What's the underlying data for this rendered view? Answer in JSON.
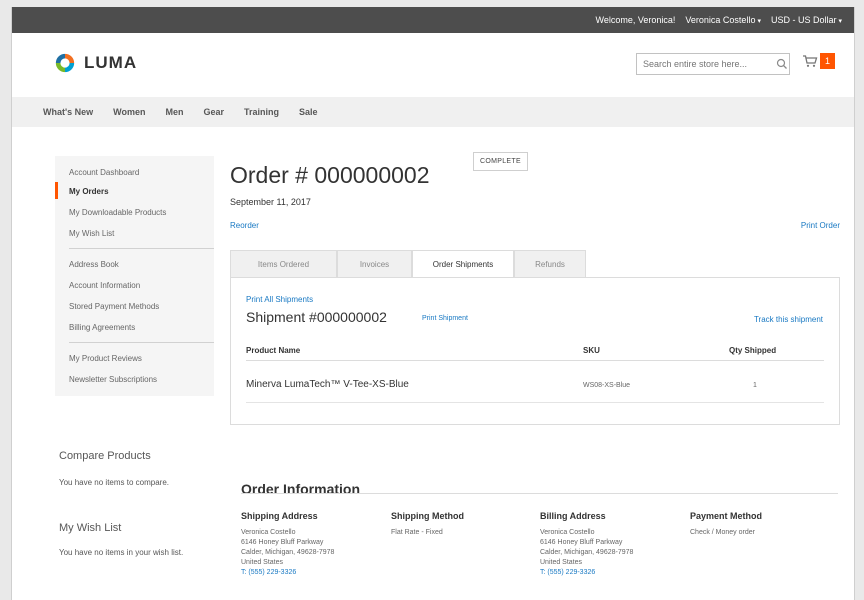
{
  "topbar": {
    "welcome": "Welcome, Veronica!",
    "account_name": "Veronica Costello",
    "currency": "USD - US Dollar"
  },
  "header": {
    "logo_text": "LUMA",
    "search_placeholder": "Search entire store here...",
    "cart_count": "1"
  },
  "nav": [
    "What's New",
    "Women",
    "Men",
    "Gear",
    "Training",
    "Sale"
  ],
  "sidebar": {
    "items": [
      "Account Dashboard",
      "My Orders",
      "My Downloadable Products",
      "My Wish List",
      "Address Book",
      "Account Information",
      "Stored Payment Methods",
      "Billing Agreements",
      "My Product Reviews",
      "Newsletter Subscriptions"
    ],
    "active_item": "My Orders",
    "compare": {
      "title": "Compare Products",
      "text": "You have no items to compare."
    },
    "wishlist": {
      "title": "My Wish List",
      "text": "You have no items in your wish list."
    }
  },
  "order": {
    "title": "Order # 000000002",
    "status": "COMPLETE",
    "date": "September 11, 2017",
    "reorder": "Reorder",
    "print_order": "Print Order"
  },
  "tabs": [
    "Items Ordered",
    "Invoices",
    "Order Shipments",
    "Refunds"
  ],
  "active_tab": "Order Shipments",
  "shipment": {
    "print_all": "Print All Shipments",
    "title": "Shipment #000000002",
    "print_shipment": "Print Shipment",
    "track": "Track this shipment",
    "columns": [
      "Product Name",
      "SKU",
      "Qty Shipped"
    ],
    "rows": [
      {
        "name": "Minerva LumaTech™ V-Tee-XS-Blue",
        "sku": "WS08-XS-Blue",
        "qty": "1"
      }
    ]
  },
  "order_info": {
    "title": "Order Information",
    "shipping_address": {
      "heading": "Shipping Address",
      "lines": [
        "Veronica Costello",
        "6146 Honey Bluff Parkway",
        "Calder, Michigan, 49628-7978",
        "United States"
      ],
      "phone": "T: (555) 229-3326"
    },
    "shipping_method": {
      "heading": "Shipping Method",
      "value": "Flat Rate - Fixed"
    },
    "billing_address": {
      "heading": "Billing Address",
      "lines": [
        "Veronica Costello",
        "6146 Honey Bluff Parkway",
        "Calder, Michigan, 49628-7978",
        "United States"
      ],
      "phone": "T: (555) 229-3326"
    },
    "payment_method": {
      "heading": "Payment Method",
      "value": "Check / Money order"
    }
  },
  "colors": {
    "accent": "#ff5501",
    "link": "#1979c3",
    "topbar": "#4d4d4d",
    "nav_bg": "#f0f0f0"
  }
}
